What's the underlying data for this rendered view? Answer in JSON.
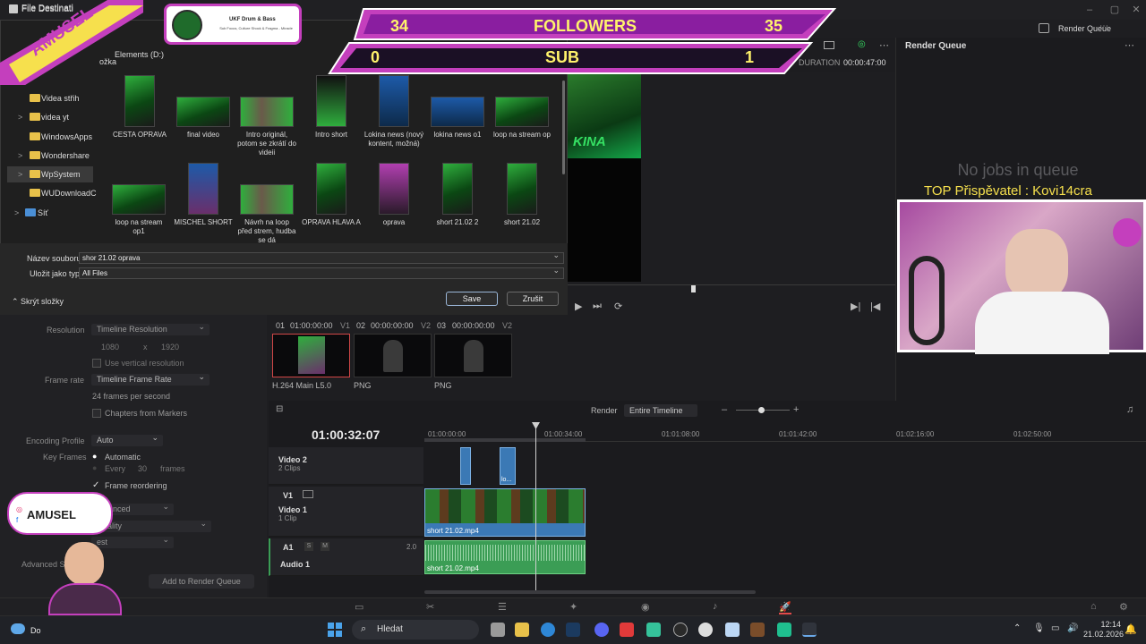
{
  "window": {
    "title": "File Destinati"
  },
  "dialog": {
    "title": "File Destinati",
    "path_label": "Elements (D:)",
    "crumb": "ožka",
    "nav_items": [
      {
        "label": "Videa střih",
        "chev": ""
      },
      {
        "label": "videa yt",
        "chev": ">"
      },
      {
        "label": "WindowsApps",
        "chev": ""
      },
      {
        "label": "Wondershare",
        "chev": ">"
      },
      {
        "label": "WpSystem",
        "chev": ">"
      },
      {
        "label": "WUDownloadC",
        "chev": ""
      },
      {
        "label": "Síť",
        "chev": ">"
      }
    ],
    "files_row1": [
      {
        "name": "CESTA OPRAVA"
      },
      {
        "name": "final video"
      },
      {
        "name": "Intro originál, potom se zkrátí do videii"
      },
      {
        "name": "Intro short"
      },
      {
        "name": "Lokina news (nový kontent, možná)"
      },
      {
        "name": "lokina news o1"
      },
      {
        "name": "loop na stream op"
      }
    ],
    "files_row2": [
      {
        "name": "loop na stream op1"
      },
      {
        "name": "MISCHEL SHORT"
      },
      {
        "name": "Návrh na loop před strem, hudba se dá"
      },
      {
        "name": "OPRAVA HLAVA A"
      },
      {
        "name": "oprava"
      },
      {
        "name": "short 21.02 2"
      },
      {
        "name": "short 21.02"
      }
    ],
    "filename_label": "Název souboru:",
    "filename_value": "shor  21.02 oprava",
    "type_label": "Uložit jako typ:",
    "type_value": "All Files",
    "hide_folders": "Skrýt složky",
    "save": "Save",
    "cancel": "Zrušit"
  },
  "render_queue": {
    "header": "Render Queue",
    "panel_title": "Render Queue",
    "empty": "No jobs in queue",
    "duration_label": "DURATION",
    "duration_value": "00:00:47:00"
  },
  "overlay": {
    "followers_left": "34",
    "followers_label": "FOLLOWERS",
    "followers_right": "35",
    "sub_left": "0",
    "sub_label": "SUB",
    "sub_right": "1",
    "top_donor": "TOP Přispěvatel : Kovi14cra",
    "brand": "AMUSEL",
    "social_brand": "AMUSEL",
    "song_title": "UKF Drum & Bass",
    "song_sub": "Sub Focus, Culture Shock & Fragma - Miracle",
    "viewer_text": "KINA"
  },
  "settings": {
    "resolution_label": "Resolution",
    "resolution_value": "Timeline Resolution",
    "res_w": "1080",
    "res_x": "x",
    "res_h": "1920",
    "vertical_label": "Use vertical resolution",
    "framerate_label": "Frame rate",
    "framerate_value": "Timeline Frame Rate",
    "fps_text": "24 frames per second",
    "chapters_label": "Chapters from Markers",
    "encoding_label": "Encoding Profile",
    "encoding_value": "Auto",
    "keyframes_label": "Key Frames",
    "kf_auto": "Automatic",
    "kf_every": "Every",
    "kf_every_n": "30",
    "kf_frames": "frames",
    "frame_reorder": "Frame reordering",
    "balanced": "Balanced",
    "quality": "Quality",
    "best": "est",
    "advanced": "Advanced S",
    "add_to_queue": "Add to Render Queue"
  },
  "clips": [
    {
      "no": "01",
      "tc": "01:00:00:00",
      "track": "V1",
      "label": "H.264 Main L5.0"
    },
    {
      "no": "02",
      "tc": "00:00:00:00",
      "track": "V2",
      "label": "PNG"
    },
    {
      "no": "03",
      "tc": "00:00:00:00",
      "track": "V2",
      "label": "PNG"
    }
  ],
  "timeline": {
    "render_label": "Render",
    "render_value": "Entire Timeline",
    "timecode": "01:00:32:07",
    "ruler": [
      "01:00:00:00",
      "01:00:34:00",
      "01:01:08:00",
      "01:01:42:00",
      "01:02:16:00",
      "01:02:50:00"
    ],
    "video2_id": "",
    "video2_name": "Video 2",
    "video2_clips": "2 Clips",
    "v1_id": "V1",
    "video1_name": "Video 1",
    "video1_clips": "1 Clip",
    "v2_clip_label": "lo...",
    "v1_clip_label": "short 21.02.mp4",
    "a1_id": "A1",
    "a1_s": "S",
    "a1_m": "M",
    "a1_level": "2.0",
    "audio1_name": "Audio 1",
    "a1_clip_label": "short 21.02.mp4"
  },
  "taskbar": {
    "search_placeholder": "Hledat",
    "time": "12:14",
    "date": "21.02.2026",
    "app_label": "Do"
  }
}
